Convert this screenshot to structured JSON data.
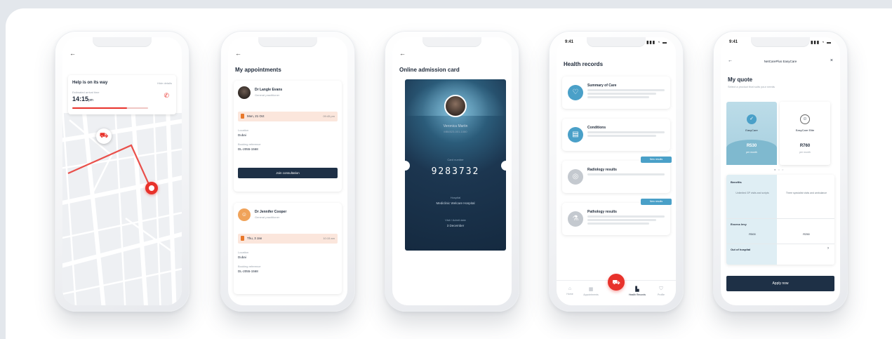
{
  "colors": {
    "accent_red": "#e8322b",
    "navy": "#1e3046",
    "teal": "#4aa0c8",
    "peach": "#fbe6dc",
    "light_blue": "#dfeef4"
  },
  "screens": {
    "help": {
      "title": "Help is on its way",
      "link": "Hide details",
      "eta_label": "Estimated arrival time",
      "eta_value": "14:15",
      "eta_unit": "pm",
      "phone_icon": "phone-icon",
      "map_icons": [
        "ambulance-icon",
        "location-pin-icon"
      ],
      "progress": 0.72
    },
    "appointments": {
      "title": "My appointments",
      "items": [
        {
          "doctor": "Dr Langle Evans",
          "specialty": "General practitioner",
          "date": "Mon, 21 Oct",
          "time": "09:45 pm",
          "location_label": "Location",
          "location": "Dubai",
          "booking_label": "Booking reference",
          "booking": "DL-2055-1568",
          "button": "Join consultation"
        },
        {
          "doctor": "Dr Jennifer Cooper",
          "specialty": "General practitioner",
          "date": "Thu, 3 Jan",
          "time": "10:15 am",
          "location_label": "Location",
          "location": "Dubai",
          "booking_label": "Booking reference",
          "booking": "DL-2055-1568"
        }
      ]
    },
    "admission": {
      "title": "Online admission card",
      "patient_name": "Veronica Martin",
      "patient_id": "MB4523-001-1080",
      "number_label": "Card number",
      "card_number": "9283732",
      "hospital_label": "Hospital",
      "hospital": "Mediclinic Welcare Hospital",
      "date_label": "Visit / Admit date",
      "date": "3 December"
    },
    "records": {
      "title": "Health records",
      "time": "9:41",
      "status_icons": "▮▮▮ ◔ ▬",
      "items": [
        {
          "title": "Summary of Care",
          "icon": "heart-icon",
          "color": "#4aa0c8"
        },
        {
          "title": "Conditions",
          "icon": "clipboard-icon",
          "color": "#4aa0c8"
        },
        {
          "title": "Radiology results",
          "icon": "scan-icon",
          "color": "#c4c9cf",
          "tag": "New results"
        },
        {
          "title": "Pathology results",
          "icon": "flask-icon",
          "color": "#c4c9cf",
          "tag": "New results"
        }
      ],
      "tabs": [
        "Home",
        "Appointments",
        "",
        "Health Records",
        "Profile"
      ]
    },
    "quotes": {
      "time": "9:41",
      "status_icons": "▮▮▮ ◔ ▬",
      "nav_title": "NetCarePlus EasyCare",
      "title": "My quote",
      "subtitle": "Select a product that suits your needs",
      "plans": [
        {
          "name": "EasyCare",
          "price": "R530",
          "period": "per month",
          "selected": true
        },
        {
          "name": "EasyCare Elite",
          "price": "R760",
          "period": "per month",
          "selected": false
        }
      ],
      "table": {
        "row1_label": "Benefits",
        "row1_a": "Unlimited GP visits and scripts",
        "row1_b": "Three specialist visits and ambulance",
        "row2_label": "Excess levy",
        "row2_a": "R500",
        "row2_b": "R250",
        "row3_label": "Out of hospital"
      },
      "apply": "Apply now"
    }
  }
}
